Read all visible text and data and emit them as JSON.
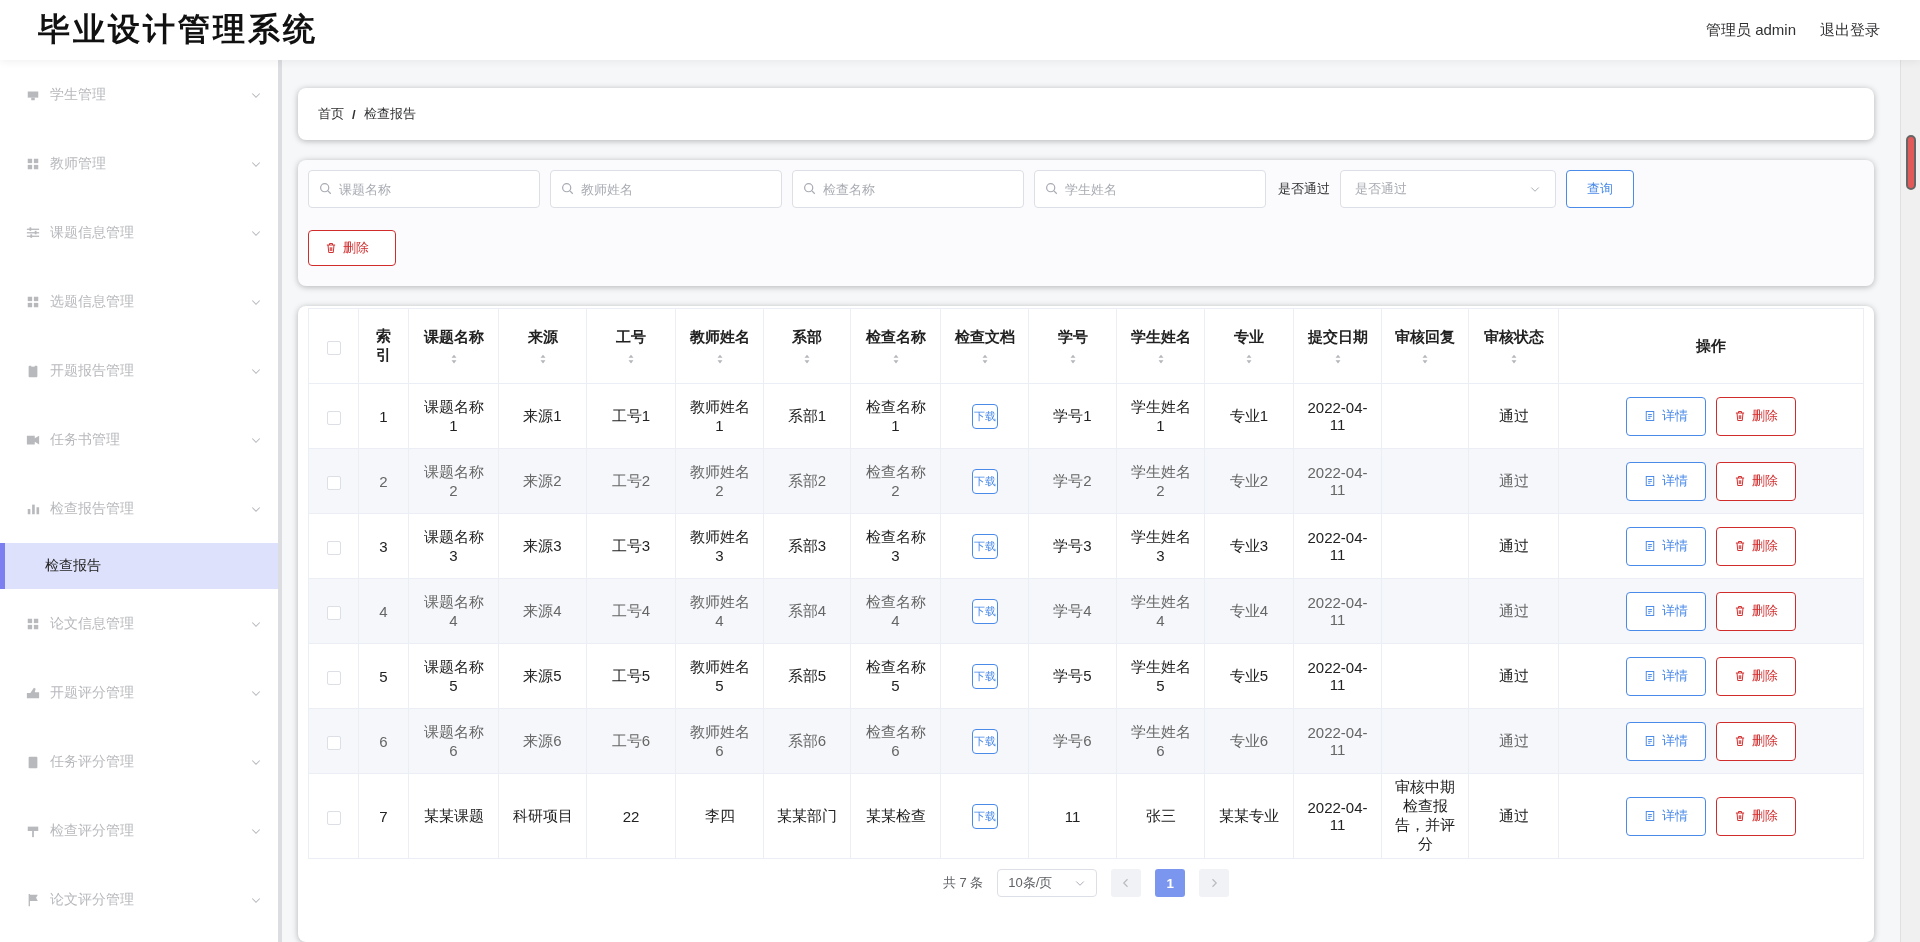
{
  "header": {
    "title": "毕业设计管理系统",
    "user": "管理员 admin",
    "logout": "退出登录"
  },
  "sidebar": {
    "items": [
      {
        "label": "学生管理"
      },
      {
        "label": "教师管理"
      },
      {
        "label": "课题信息管理"
      },
      {
        "label": "选题信息管理"
      },
      {
        "label": "开题报告管理"
      },
      {
        "label": "任务书管理"
      },
      {
        "label": "检查报告管理",
        "children": [
          {
            "label": "检查报告",
            "selected": true
          }
        ]
      },
      {
        "label": "论文信息管理"
      },
      {
        "label": "开题评分管理"
      },
      {
        "label": "任务评分管理"
      },
      {
        "label": "检查评分管理"
      },
      {
        "label": "论文评分管理"
      }
    ]
  },
  "breadcrumb": {
    "items": [
      "首页",
      "检查报告"
    ],
    "separator": "/"
  },
  "filters": {
    "fields": [
      {
        "placeholder": "课题名称"
      },
      {
        "placeholder": "教师姓名"
      },
      {
        "placeholder": "检查名称"
      },
      {
        "placeholder": "学生姓名"
      }
    ],
    "pass_label": "是否通过",
    "pass_select": {
      "placeholder": "是否通过"
    },
    "query_button": "查询",
    "delete_button": "删除"
  },
  "table": {
    "select_all": {
      "checked": false
    },
    "columns": [
      {
        "label": "索引",
        "kind": "text",
        "sortable": false
      },
      {
        "label": "课题名称",
        "kind": "text",
        "sortable": true
      },
      {
        "label": "来源",
        "kind": "text",
        "sortable": true
      },
      {
        "label": "工号",
        "kind": "text",
        "sortable": true
      },
      {
        "label": "教师姓名",
        "kind": "text",
        "sortable": true
      },
      {
        "label": "系部",
        "kind": "text",
        "sortable": true
      },
      {
        "label": "检查名称",
        "kind": "text",
        "sortable": true
      },
      {
        "label": "检查文档",
        "kind": "download",
        "sortable": true
      },
      {
        "label": "学号",
        "kind": "text",
        "sortable": true
      },
      {
        "label": "学生姓名",
        "kind": "text",
        "sortable": true
      },
      {
        "label": "专业",
        "kind": "text",
        "sortable": true
      },
      {
        "label": "提交日期",
        "kind": "text",
        "sortable": true
      },
      {
        "label": "审核回复",
        "kind": "text",
        "sortable": true
      },
      {
        "label": "审核状态",
        "kind": "text",
        "sortable": true
      },
      {
        "label": "操作",
        "kind": "actions",
        "sortable": false
      }
    ],
    "rows": [
      {
        "checked": false,
        "cells": [
          "1",
          "课题名称1",
          "来源1",
          "工号1",
          "教师姓名1",
          "系部1",
          "检查名称1",
          "下载",
          "学号1",
          "学生姓名1",
          "专业1",
          "2022-04-11",
          "",
          "通过"
        ],
        "actions": [
          "详情",
          "删除"
        ]
      },
      {
        "checked": false,
        "cells": [
          "2",
          "课题名称2",
          "来源2",
          "工号2",
          "教师姓名2",
          "系部2",
          "检查名称2",
          "下载",
          "学号2",
          "学生姓名2",
          "专业2",
          "2022-04-11",
          "",
          "通过"
        ],
        "actions": [
          "详情",
          "删除"
        ]
      },
      {
        "checked": false,
        "cells": [
          "3",
          "课题名称3",
          "来源3",
          "工号3",
          "教师姓名3",
          "系部3",
          "检查名称3",
          "下载",
          "学号3",
          "学生姓名3",
          "专业3",
          "2022-04-11",
          "",
          "通过"
        ],
        "actions": [
          "详情",
          "删除"
        ]
      },
      {
        "checked": false,
        "cells": [
          "4",
          "课题名称4",
          "来源4",
          "工号4",
          "教师姓名4",
          "系部4",
          "检查名称4",
          "下载",
          "学号4",
          "学生姓名4",
          "专业4",
          "2022-04-11",
          "",
          "通过"
        ],
        "actions": [
          "详情",
          "删除"
        ]
      },
      {
        "checked": false,
        "cells": [
          "5",
          "课题名称5",
          "来源5",
          "工号5",
          "教师姓名5",
          "系部5",
          "检查名称5",
          "下载",
          "学号5",
          "学生姓名5",
          "专业5",
          "2022-04-11",
          "",
          "通过"
        ],
        "actions": [
          "详情",
          "删除"
        ]
      },
      {
        "checked": false,
        "cells": [
          "6",
          "课题名称6",
          "来源6",
          "工号6",
          "教师姓名6",
          "系部6",
          "检查名称6",
          "下载",
          "学号6",
          "学生姓名6",
          "专业6",
          "2022-04-11",
          "",
          "通过"
        ],
        "actions": [
          "详情",
          "删除"
        ]
      },
      {
        "checked": false,
        "cells": [
          "7",
          "某某课题",
          "科研项目",
          "22",
          "李四",
          "某某部门",
          "某某检查",
          "下载",
          "11",
          "张三",
          "某某专业",
          "2022-04-11",
          "审核中期检查报告，并评分",
          "通过"
        ],
        "actions": [
          "详情",
          "删除"
        ]
      }
    ]
  },
  "pagination": {
    "total": "共 7 条",
    "page_size": "10条/页",
    "pages": [
      {
        "label": "1",
        "selected": true
      }
    ]
  }
}
